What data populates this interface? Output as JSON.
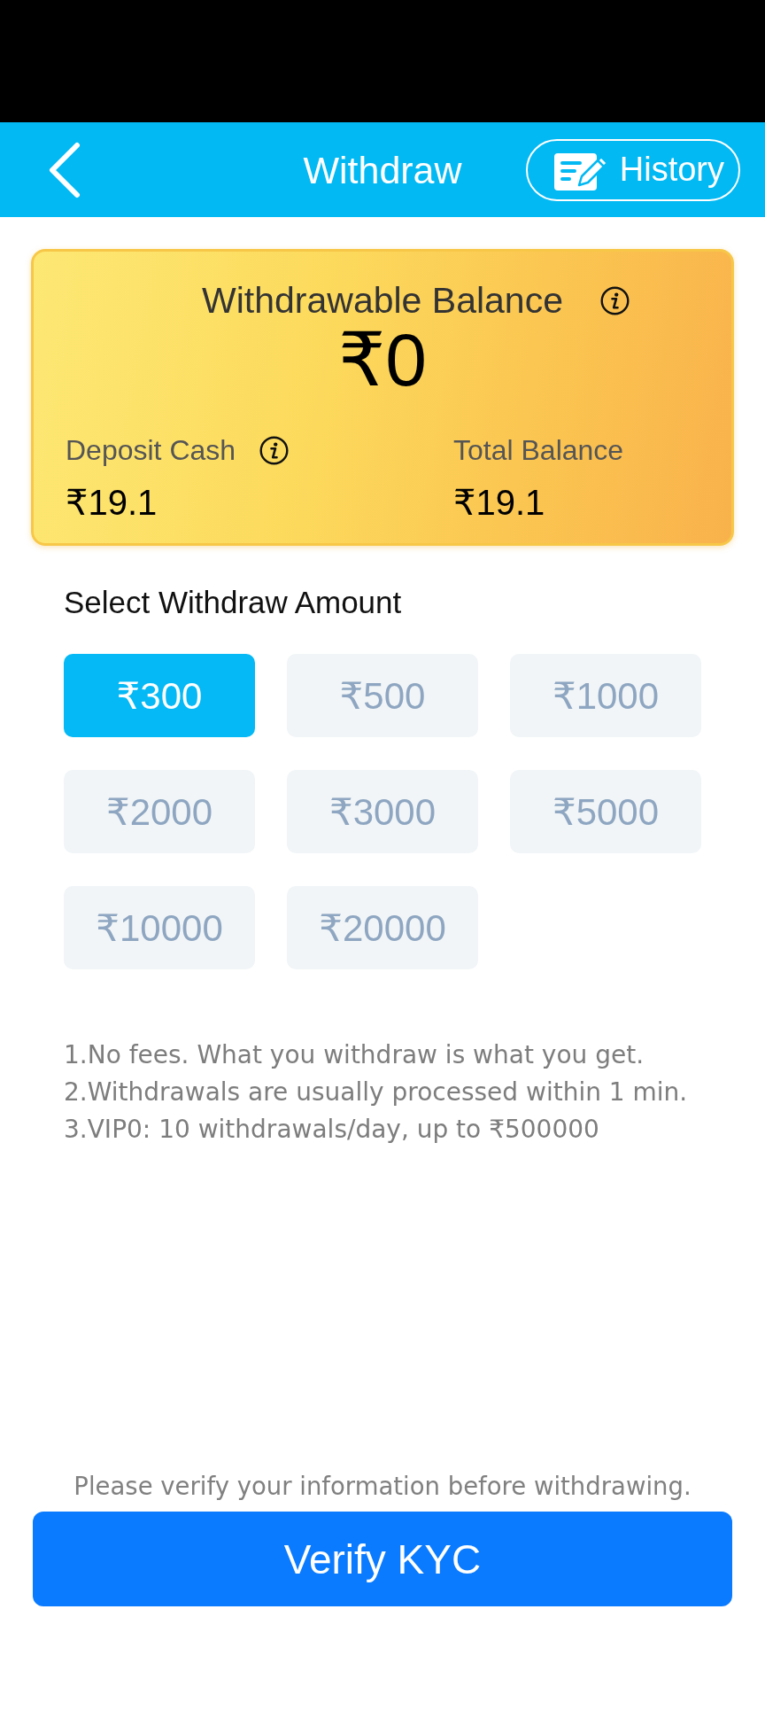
{
  "header": {
    "title": "Withdraw",
    "history_button": {
      "label": "History"
    }
  },
  "balance_card": {
    "title": "Withdrawable Balance",
    "title_info": true,
    "amount": "₹0",
    "items": [
      {
        "label": "Deposit Cash",
        "value": "₹19.1",
        "info": true
      },
      {
        "label": "Total Balance",
        "value": "₹19.1",
        "info": false
      }
    ]
  },
  "amount_section": {
    "title": "Select Withdraw Amount",
    "options": [
      {
        "label": "₹300",
        "selected": true
      },
      {
        "label": "₹500",
        "selected": false
      },
      {
        "label": "₹1000",
        "selected": false
      },
      {
        "label": "₹2000",
        "selected": false
      },
      {
        "label": "₹3000",
        "selected": false
      },
      {
        "label": "₹5000",
        "selected": false
      },
      {
        "label": "₹10000",
        "selected": false
      },
      {
        "label": "₹20000",
        "selected": false
      }
    ]
  },
  "notes": [
    "1.No fees. What you withdraw is what you get.",
    "2.Withdrawals are usually processed within 1 min.",
    "3.VIP0: 10 withdrawals/day, up to ₹500000"
  ],
  "footer": {
    "hint": "Please verify your information before withdrawing.",
    "button": "Verify KYC"
  }
}
